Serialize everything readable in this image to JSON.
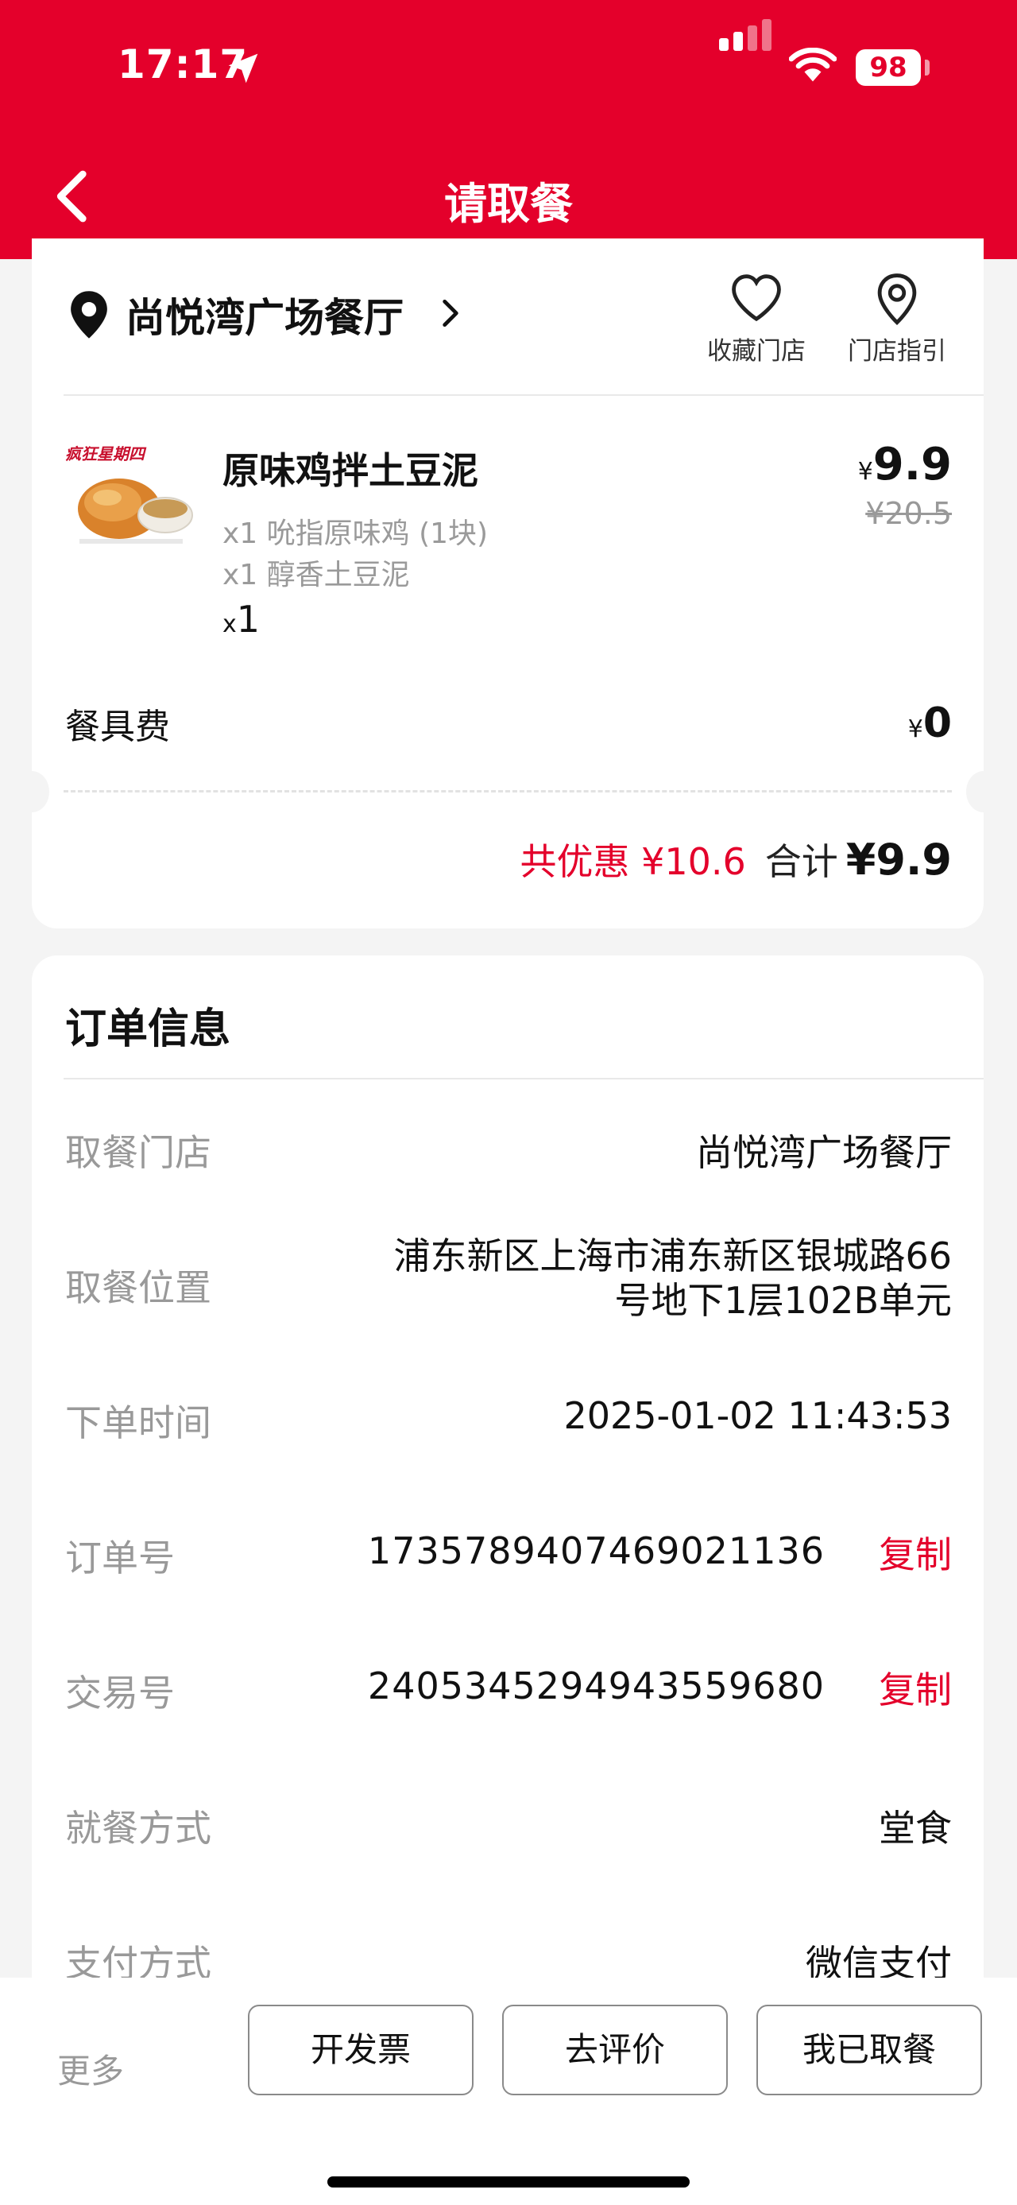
{
  "status_bar": {
    "time": "17:17",
    "battery": "98"
  },
  "header": {
    "title": "请取餐"
  },
  "store": {
    "name": "尚悦湾广场餐厅",
    "favorite_label": "收藏门店",
    "guide_label": "门店指引"
  },
  "order_item": {
    "name": "原味鸡拌土豆泥",
    "components": [
      "x1 吮指原味鸡 (1块)",
      "x1 醇香土豆泥"
    ],
    "qty_prefix": "x",
    "qty": "1",
    "currency": "¥",
    "price": "9.9",
    "original_price": "¥20.5"
  },
  "tableware": {
    "label": "餐具费",
    "currency": "¥",
    "price": "0"
  },
  "summary": {
    "discount_text": "共优惠 ¥10.6",
    "total_label": "合计",
    "total": "¥9.9"
  },
  "order_info": {
    "title": "订单信息",
    "pickup_store_label": "取餐门店",
    "pickup_store_value": "尚悦湾广场餐厅",
    "pickup_location_label": "取餐位置",
    "pickup_location_line1": "浦东新区上海市浦东新区银城路66",
    "pickup_location_line2": "号地下1层102B单元",
    "order_time_label": "下单时间",
    "order_time_value": "2025-01-02 11:43:53",
    "order_no_label": "订单号",
    "order_no_value": "1735789407469021136",
    "transaction_no_label": "交易号",
    "transaction_no_value": "2405345294943559680",
    "copy_label": "复制",
    "dining_mode_label": "就餐方式",
    "dining_mode_value": "堂食",
    "payment_label": "支付方式",
    "payment_value": "微信支付"
  },
  "bottom_bar": {
    "more": "更多",
    "invoice": "开发票",
    "review": "去评价",
    "picked_up": "我已取餐"
  },
  "colors": {
    "brand_red": "#e4002b"
  }
}
